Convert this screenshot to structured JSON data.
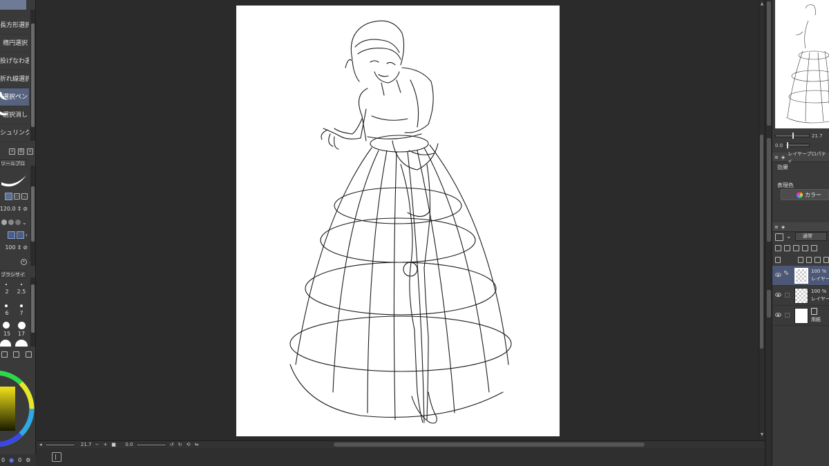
{
  "left_panel": {
    "tools": [
      {
        "label": "長方形選択",
        "active": false
      },
      {
        "label": "楕円選択",
        "active": false
      },
      {
        "label": "投げなわ選択",
        "active": false
      },
      {
        "label": "折れ線選択",
        "active": false
      },
      {
        "label": "選択ペン",
        "active": true
      },
      {
        "label": "選択消し",
        "active": false
      },
      {
        "label": "シュリンク選択",
        "active": false
      }
    ],
    "tool_property_tab": "ツールプロパティ[選択ペン]",
    "brush_size_value": "120.0",
    "opacity_value": "100",
    "brush_size_tab": "ブラシサイズ[選択ペン]",
    "brush_sizes": [
      "2",
      "2.5",
      "6",
      "7",
      "15",
      "17"
    ],
    "bottom_values": [
      "0",
      "0"
    ]
  },
  "canvas": {
    "zoom": "21.7",
    "rotation": "0.0"
  },
  "right_panel": {
    "nav_zoom": "21.7",
    "nav_rotation": "0.0",
    "layer_property_tab": "レイヤープロパティ",
    "effect_label": "効果",
    "expression_color_label": "表現色",
    "color_button_label": "カラー",
    "blend_mode": "通常",
    "layers": [
      {
        "opacity": "100 %",
        "name": "レイヤー",
        "active": true,
        "paper": false
      },
      {
        "opacity": "100 %",
        "name": "レイヤー",
        "active": false,
        "paper": false
      },
      {
        "opacity": "",
        "name": "用紙",
        "active": false,
        "paper": true
      }
    ]
  }
}
